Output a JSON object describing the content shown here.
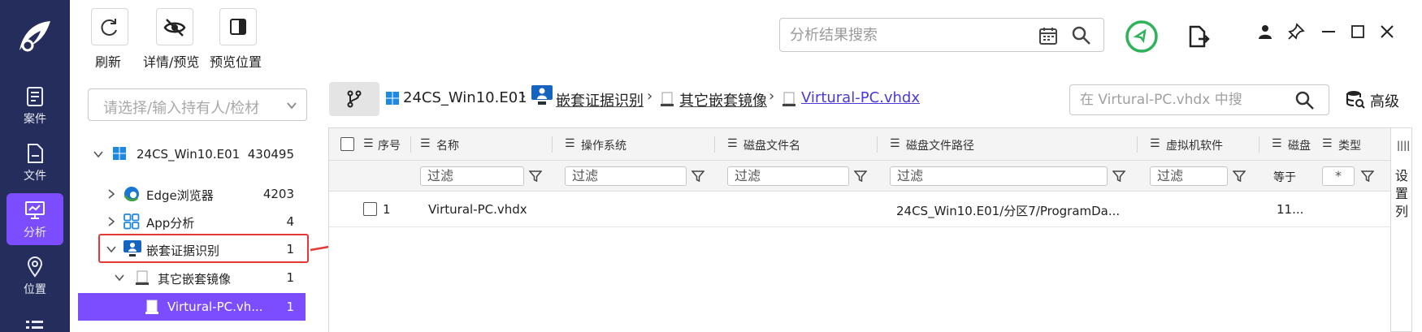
{
  "toolbar": {
    "refresh_label": "刷新",
    "details_label": "详情/预览",
    "preview_pos_label": "预览位置"
  },
  "top_search": {
    "placeholder": "分析结果搜索"
  },
  "nav": {
    "cases": "案件",
    "files": "文件",
    "analysis": "分析",
    "location": "位置"
  },
  "owner_select": {
    "placeholder": "请选择/输入持有人/检材"
  },
  "tree": {
    "root": {
      "label": "24CS_Win10.E01",
      "count": "430495"
    },
    "edge": {
      "label": "Edge浏览器",
      "count": "4203"
    },
    "app": {
      "label": "App分析",
      "count": "4"
    },
    "nested": {
      "label": "嵌套证据识别",
      "count": "1"
    },
    "other_images": {
      "label": "其它嵌套镜像",
      "count": "1"
    },
    "vhd": {
      "label": "Virtural-PC.vh...",
      "count": "1"
    }
  },
  "breadcrumb": {
    "c1": "24CS_Win10.E01",
    "c2": "嵌套证据识别",
    "c3": "其它嵌套镜像",
    "c4": "Virtural-PC.vhdx",
    "sep": "›"
  },
  "sub_search": {
    "placeholder": "在 Virtural-PC.vhdx 中搜"
  },
  "advanced_label": "高级",
  "table": {
    "headers": {
      "index": "序号",
      "name": "名称",
      "os": "操作系统",
      "disk_file": "磁盘文件名",
      "disk_path": "磁盘文件路径",
      "vm_software": "虚拟机软件",
      "disk_size": "磁盘",
      "type": "类型"
    },
    "filter_text": "过滤",
    "equals_text": "等于",
    "star_text": "*",
    "rows": [
      {
        "index": "1",
        "name": "Virtural-PC.vhdx",
        "path": "24CS_Win10.E01/分区7/ProgramDa...",
        "size": "11..."
      }
    ]
  },
  "column_settings": "设置列",
  "colors": {
    "rail": "#252d5c",
    "accent": "#7c4dff",
    "alert": "#e53935",
    "ok": "#2fb25a"
  }
}
